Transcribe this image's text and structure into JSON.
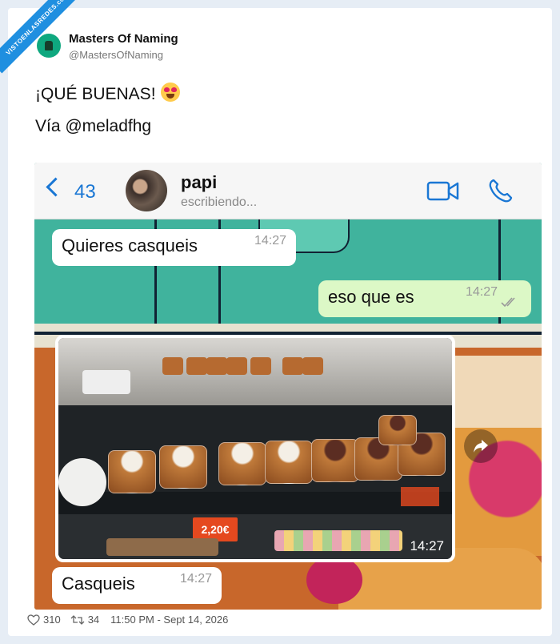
{
  "watermark": {
    "text": "VISTOENLASREDES.com"
  },
  "author": {
    "name": "Masters Of Naming",
    "handle": "@MastersOfNaming"
  },
  "tweet": {
    "line1": "¡QUÉ BUENAS!",
    "line2": "Vía @meladfhg"
  },
  "chat": {
    "back_count": "43",
    "contact_name": "papi",
    "contact_status": "escribiendo...",
    "icons": [
      "back-chevron-icon",
      "video-call-icon",
      "phone-call-icon",
      "forward-icon"
    ],
    "messages": [
      {
        "direction": "in",
        "text": "Quieres casqueis",
        "time": "14:27"
      },
      {
        "direction": "out",
        "text": "eso que es",
        "time": "14:27",
        "status": "read"
      },
      {
        "direction": "in",
        "type": "photo",
        "time": "14:27",
        "price_tag": "2,20€"
      },
      {
        "direction": "in",
        "text": "Casqueis",
        "time": "14:27"
      }
    ]
  },
  "footer": {
    "likes": "310",
    "retweets": "34",
    "timestamp": "11:50 PM - Sept 14, 2026"
  },
  "colors": {
    "accent": "#1a77d4",
    "out_bubble": "#dcf8c6",
    "in_bubble": "#ffffff"
  }
}
